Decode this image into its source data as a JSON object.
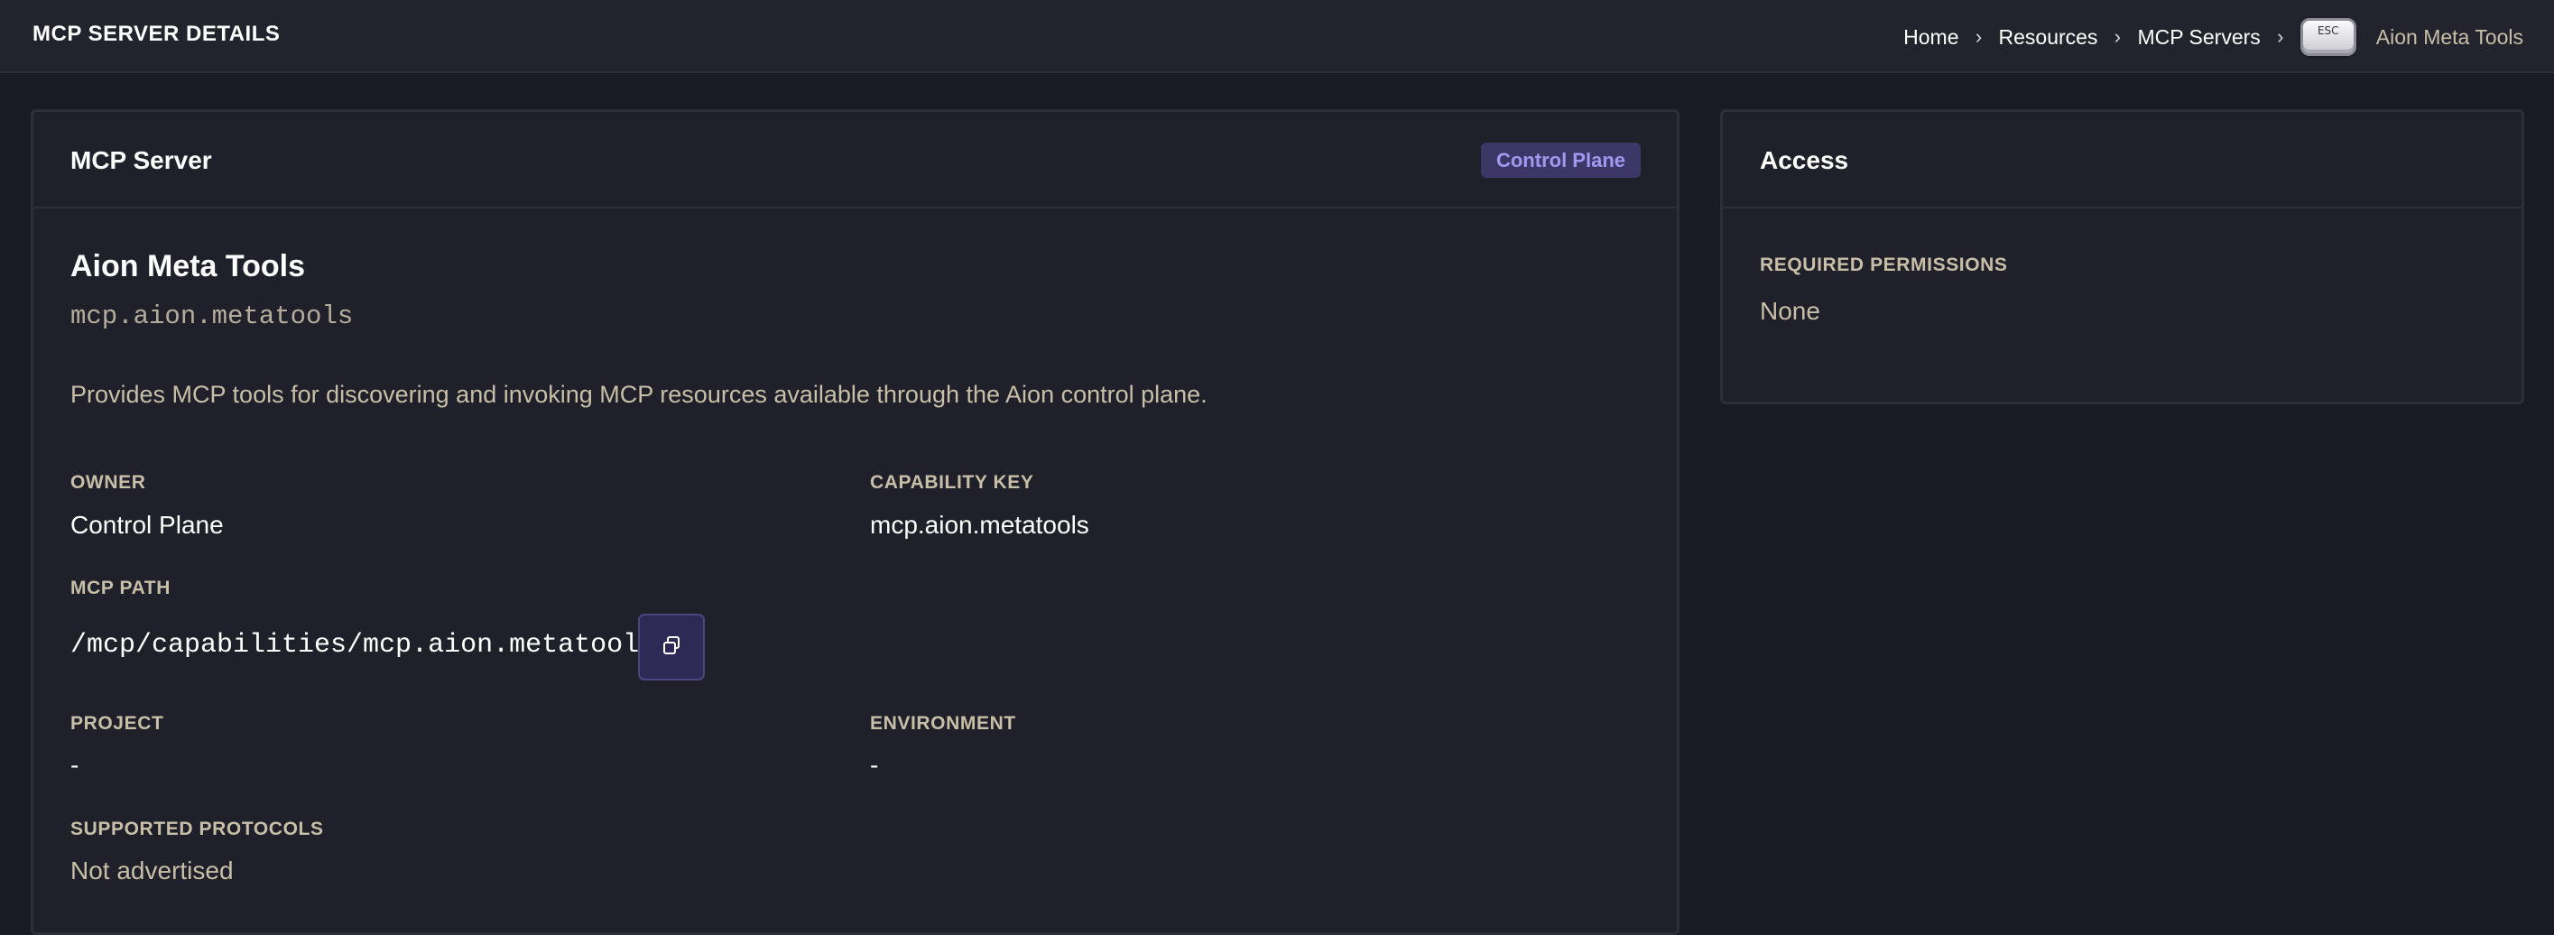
{
  "header": {
    "title": "MCP SERVER DETAILS",
    "breadcrumb": [
      "Home",
      "Resources",
      "MCP Servers"
    ],
    "breadcrumb_separator": "›",
    "esc_label": "ESC",
    "current": "Aion Meta Tools"
  },
  "server_card": {
    "title": "MCP Server",
    "badge": "Control Plane",
    "name": "Aion Meta Tools",
    "id": "mcp.aion.metatools",
    "description": "Provides MCP tools for discovering and invoking MCP resources available through the Aion control plane.",
    "owner_label": "OWNER",
    "owner_value": "Control Plane",
    "capability_key_label": "CAPABILITY KEY",
    "capability_key_value": "mcp.aion.metatools",
    "mcp_path_label": "MCP PATH",
    "mcp_path_value": "/mcp/capabilities/mcp.aion.metatools",
    "copy_icon": "copy-icon",
    "project_label": "PROJECT",
    "project_value": "-",
    "environment_label": "ENVIRONMENT",
    "environment_value": "-",
    "protocols_label": "SUPPORTED PROTOCOLS",
    "protocols_value": "Not advertised"
  },
  "access_card": {
    "title": "Access",
    "permissions_label": "REQUIRED PERMISSIONS",
    "permissions_value": "None"
  },
  "colors": {
    "background": "#1a1a22",
    "card": "#20202a",
    "badge_bg": "#3d3768",
    "badge_text": "#a596f0",
    "muted_text": "#c8bfa8",
    "copy_button": "#2d2a55"
  }
}
